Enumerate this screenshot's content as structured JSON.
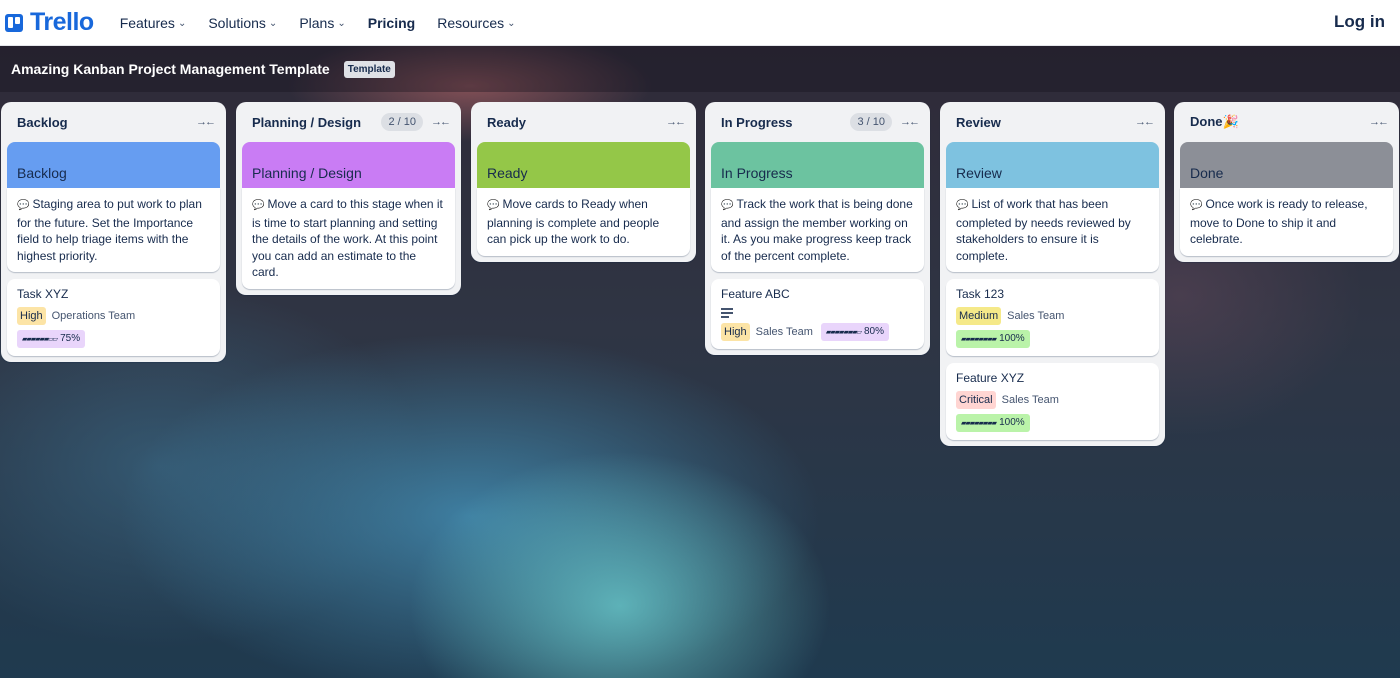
{
  "nav": {
    "logo": "Trello",
    "items": [
      {
        "label": "Features",
        "has_menu": true
      },
      {
        "label": "Solutions",
        "has_menu": true
      },
      {
        "label": "Plans",
        "has_menu": true
      },
      {
        "label": "Pricing",
        "has_menu": false
      },
      {
        "label": "Resources",
        "has_menu": true
      }
    ],
    "login": "Log in"
  },
  "board": {
    "title": "Amazing Kanban Project Management Template",
    "badge": "Template"
  },
  "lists": [
    {
      "name": "Backlog",
      "count": "",
      "cover_title": "Backlog",
      "cover_color": "#669df1",
      "description": "Staging area to put work to plan for the future. Set the Importance field to help triage items with the highest priority.",
      "cards": [
        {
          "title": "Task XYZ",
          "label": "High",
          "label_bg": "#fce4a6",
          "team": "Operations Team",
          "progress_bar": "▰▰▰▰▰▰▱▱",
          "progress": "75%",
          "progress_bg": "#e9d5fb",
          "has_description": false
        }
      ]
    },
    {
      "name": "Planning / Design",
      "count": "2 / 10",
      "cover_title": "Planning / Design",
      "cover_color": "#c97cf4",
      "description": "Move a card to this stage when it is time to start planning and setting the details of the work. At this point you can add an estimate to the card.",
      "cards": []
    },
    {
      "name": "Ready",
      "count": "",
      "cover_title": "Ready",
      "cover_color": "#94c748",
      "description": "Move cards to Ready when planning is complete and people can pick up the work to do.",
      "cards": []
    },
    {
      "name": "In Progress",
      "count": "3 / 10",
      "cover_title": "In Progress",
      "cover_color": "#6cc3a0",
      "description": "Track the work that is being done and assign the member working on it. As you make progress keep track of the percent complete.",
      "cards": [
        {
          "title": "Feature ABC",
          "label": "High",
          "label_bg": "#fce4a6",
          "team": "Sales Team",
          "progress_bar": "▰▰▰▰▰▰▰▱",
          "progress": "80%",
          "progress_bg": "#e9d5fb",
          "has_description": true
        }
      ]
    },
    {
      "name": "Review",
      "count": "",
      "cover_title": "Review",
      "cover_color": "#7ec2e0",
      "description": "List of work that has been completed by needs reviewed by stakeholders to ensure it is complete.",
      "cards": [
        {
          "title": "Task 123",
          "label": "Medium",
          "label_bg": "#f5e989",
          "team": "Sales Team",
          "progress_bar": "▰▰▰▰▰▰▰▰",
          "progress": "100%",
          "progress_bg": "#baf3a9",
          "has_description": false
        },
        {
          "title": "Feature XYZ",
          "label": "Critical",
          "label_bg": "#ffd5d2",
          "team": "Sales Team",
          "progress_bar": "▰▰▰▰▰▰▰▰",
          "progress": "100%",
          "progress_bg": "#baf3a9",
          "has_description": false
        }
      ]
    },
    {
      "name": "Done",
      "count": "",
      "emoji": "🎉",
      "cover_title": "Done",
      "cover_color": "#8c8f97",
      "description": "Once work is ready to release, move to Done to ship it and celebrate.",
      "cards": []
    }
  ]
}
